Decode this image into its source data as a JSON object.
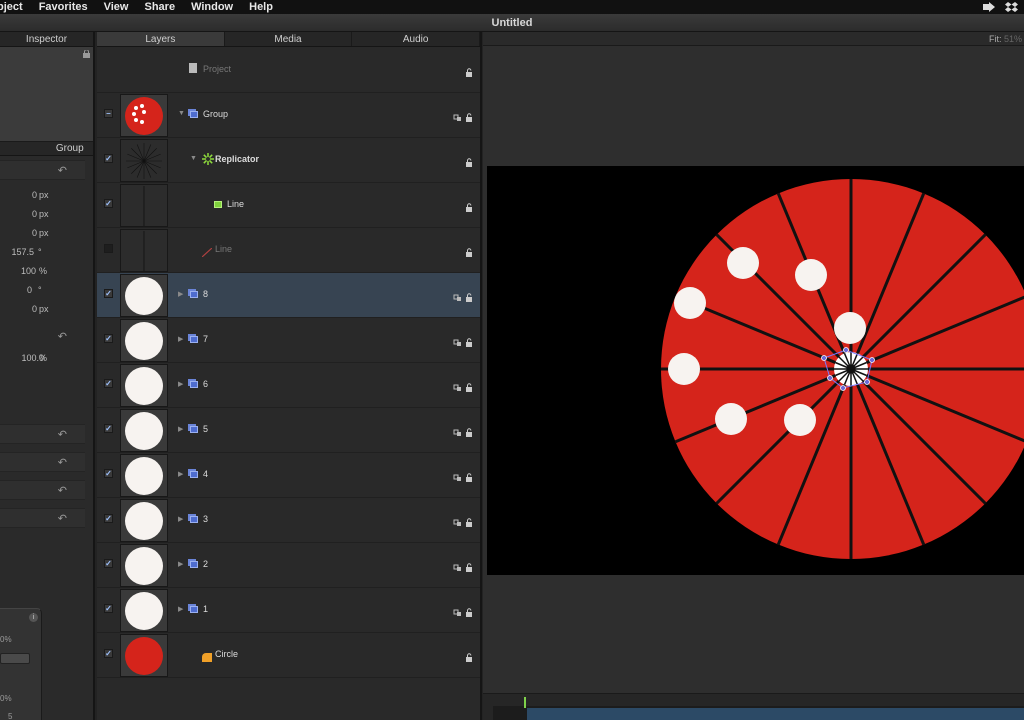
{
  "menubar": {
    "items": [
      "bject",
      "Favorites",
      "View",
      "Share",
      "Window",
      "Help"
    ]
  },
  "window": {
    "title": "Untitled"
  },
  "inspector": {
    "tab_label": "Inspector",
    "subtab_group": "Group",
    "rows": [
      {
        "value": "0",
        "unit": "px"
      },
      {
        "value": "0",
        "unit": "px"
      },
      {
        "value": "0",
        "unit": "px"
      },
      {
        "value": "157.5",
        "unit": "°"
      },
      {
        "value": "100",
        "unit": "%"
      },
      {
        "value": "0",
        "unit": "°"
      },
      {
        "value": "0",
        "unit": "px"
      }
    ],
    "opacity_value": "100.0",
    "opacity_unit": "%",
    "hud_text_1": "0%",
    "hud_text_2": "0%",
    "hud_text_3": "5"
  },
  "tabs": {
    "layers": "Layers",
    "media": "Media",
    "audio": "Audio"
  },
  "layers": [
    {
      "name": "Project",
      "enabled": null,
      "dim": true,
      "indent": 0,
      "type": "project"
    },
    {
      "name": "Group",
      "enabled": "partial",
      "dim": false,
      "indent": 0,
      "type": "group",
      "expanded": true
    },
    {
      "name": "Replicator",
      "enabled": true,
      "dim": false,
      "indent": 1,
      "type": "replicator",
      "expanded": true
    },
    {
      "name": "Line",
      "enabled": true,
      "dim": false,
      "indent": 2,
      "type": "line-green"
    },
    {
      "name": "Line",
      "enabled": false,
      "dim": true,
      "indent": 1,
      "type": "line-red"
    },
    {
      "name": "8",
      "enabled": true,
      "dim": false,
      "indent": 0,
      "type": "group-collapsed",
      "selected": true
    },
    {
      "name": "7",
      "enabled": true,
      "dim": false,
      "indent": 0,
      "type": "group-collapsed"
    },
    {
      "name": "6",
      "enabled": true,
      "dim": false,
      "indent": 0,
      "type": "group-collapsed"
    },
    {
      "name": "5",
      "enabled": true,
      "dim": false,
      "indent": 0,
      "type": "group-collapsed"
    },
    {
      "name": "4",
      "enabled": true,
      "dim": false,
      "indent": 0,
      "type": "group-collapsed"
    },
    {
      "name": "3",
      "enabled": true,
      "dim": false,
      "indent": 0,
      "type": "group-collapsed"
    },
    {
      "name": "2",
      "enabled": true,
      "dim": false,
      "indent": 0,
      "type": "group-collapsed"
    },
    {
      "name": "1",
      "enabled": true,
      "dim": false,
      "indent": 0,
      "type": "group-collapsed"
    },
    {
      "name": "Circle",
      "enabled": true,
      "dim": false,
      "indent": 1,
      "type": "shape"
    }
  ],
  "canvas": {
    "fit_label": "Fit:",
    "fit_value": "51%",
    "wheel_color": "#d5241b",
    "dot_color": "#f7f3f0"
  },
  "icons": [
    "dropbox-icon",
    "share-arrow-icon",
    "lock-icon",
    "link-icon",
    "reset-arrow-icon"
  ]
}
